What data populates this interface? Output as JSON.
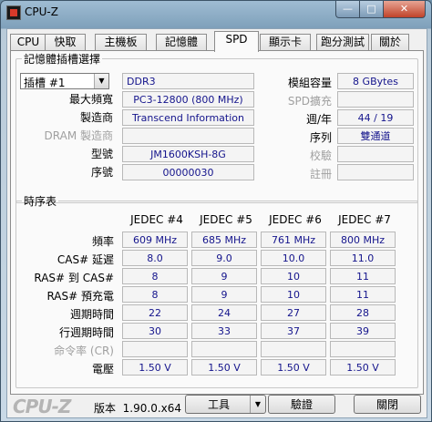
{
  "window": {
    "title": "CPU-Z",
    "minimize": "—",
    "maximize": "□",
    "close": "✕"
  },
  "tabs": [
    "CPU",
    "快取",
    "主機板",
    "記憶體",
    "SPD",
    "顯示卡",
    "跑分測試",
    "關於"
  ],
  "active_tab": "SPD",
  "slot": {
    "legend": "記憶體插槽選擇",
    "select_value": "插槽 #1",
    "type": "DDR3",
    "labels": {
      "max_bw": "最大頻寬",
      "manufacturer": "製造商",
      "dram_mfr": "DRAM 製造商",
      "part": "型號",
      "serial": "序號",
      "module_size": "模組容量",
      "spd_ext": "SPD擴充",
      "week_year": "週/年",
      "ranks": "序列",
      "correction": "校驗",
      "registered": "註冊"
    },
    "values": {
      "max_bw": "PC3-12800 (800 MHz)",
      "manufacturer": "Transcend Information",
      "dram_mfr": "",
      "part": "JM1600KSH-8G",
      "serial": "00000030",
      "module_size": "8 GBytes",
      "spd_ext": "",
      "week_year": "44 / 19",
      "ranks": "雙通道",
      "correction": "",
      "registered": ""
    }
  },
  "timings": {
    "legend": "時序表",
    "columns": [
      "JEDEC #4",
      "JEDEC #5",
      "JEDEC #6",
      "JEDEC #7"
    ],
    "rows": [
      {
        "label": "頻率",
        "values": [
          "609 MHz",
          "685 MHz",
          "761 MHz",
          "800 MHz"
        ]
      },
      {
        "label": "CAS# 延遲",
        "values": [
          "8.0",
          "9.0",
          "10.0",
          "11.0"
        ]
      },
      {
        "label": "RAS# 到 CAS#",
        "values": [
          "8",
          "9",
          "10",
          "11"
        ]
      },
      {
        "label": "RAS# 預充電",
        "values": [
          "8",
          "9",
          "10",
          "11"
        ]
      },
      {
        "label": "週期時間",
        "values": [
          "22",
          "24",
          "27",
          "28"
        ]
      },
      {
        "label": "行週期時間",
        "values": [
          "30",
          "33",
          "37",
          "39"
        ]
      },
      {
        "label": "命令率 (CR)",
        "values": [
          "",
          "",
          "",
          ""
        ]
      },
      {
        "label": "電壓",
        "values": [
          "1.50 V",
          "1.50 V",
          "1.50 V",
          "1.50 V"
        ]
      }
    ]
  },
  "footer": {
    "logo": "CPU-Z",
    "version_label": "版本",
    "version": "1.90.0.x64",
    "tools": "工具",
    "validate": "驗證",
    "close": "關閉"
  }
}
